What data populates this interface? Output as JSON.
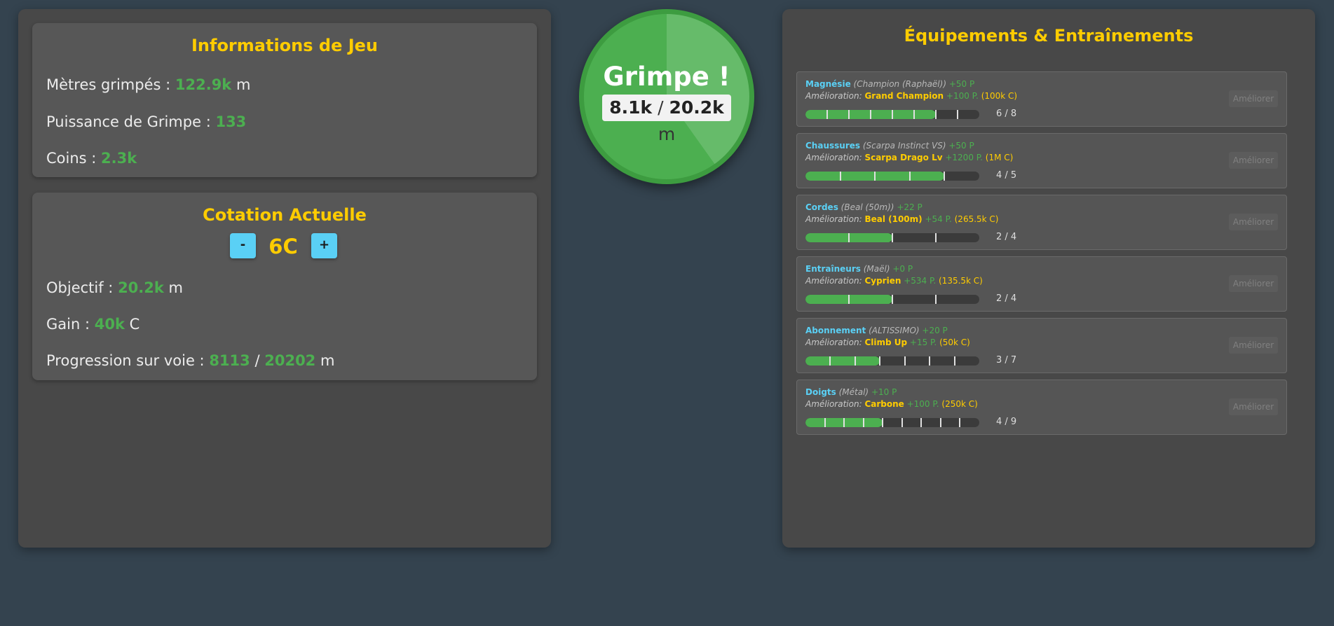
{
  "info": {
    "title": "Informations de Jeu",
    "meters_label": "Mètres grimpés :",
    "meters_value": "122.9k",
    "meters_unit": "m",
    "power_label": "Puissance de Grimpe :",
    "power_value": "133",
    "coins_label": "Coins :",
    "coins_value": "2.3k"
  },
  "grade": {
    "title": "Cotation Actuelle",
    "minus": "-",
    "plus": "+",
    "value": "6C",
    "objective_label": "Objectif :",
    "objective_value": "20.2k",
    "objective_unit": "m",
    "gain_label": "Gain :",
    "gain_value": "40k",
    "gain_unit": "C",
    "progress_label": "Progression sur voie :",
    "progress_current": "8113",
    "progress_sep": "/",
    "progress_total": "20202",
    "progress_unit": "m"
  },
  "climb": {
    "title": "Grimpe !",
    "current": "8.1k",
    "sep": "/",
    "target": "20.2k",
    "unit": "m",
    "progress_fraction": 0.4016
  },
  "equipment": {
    "title": "Équipements & Entraînements",
    "upgrade_label": "Amélioration:",
    "button_label": "Améliorer",
    "items": [
      {
        "name": "Magnésie",
        "current": "(Champion (Raphaël))",
        "bonus": "+50 P",
        "next": "Grand Champion",
        "next_bonus": "+100 P.",
        "cost": "(100k C)",
        "level": 6,
        "max": 8,
        "level_text": "6 / 8"
      },
      {
        "name": "Chaussures",
        "current": "(Scarpa Instinct VS)",
        "bonus": "+50 P",
        "next": "Scarpa Drago Lv",
        "next_bonus": "+1200 P.",
        "cost": "(1M C)",
        "level": 4,
        "max": 5,
        "level_text": "4 / 5"
      },
      {
        "name": "Cordes",
        "current": "(Beal (50m))",
        "bonus": "+22 P",
        "next": "Beal (100m)",
        "next_bonus": "+54 P.",
        "cost": "(265.5k C)",
        "level": 2,
        "max": 4,
        "level_text": "2 / 4"
      },
      {
        "name": "Entraîneurs",
        "current": "(Maël)",
        "bonus": "+0 P",
        "next": "Cyprien",
        "next_bonus": "+534 P.",
        "cost": "(135.5k C)",
        "level": 2,
        "max": 4,
        "level_text": "2 / 4"
      },
      {
        "name": "Abonnement",
        "current": "(ALTISSIMO)",
        "bonus": "+20 P",
        "next": "Climb Up",
        "next_bonus": "+15 P.",
        "cost": "(50k C)",
        "level": 3,
        "max": 7,
        "level_text": "3 / 7"
      },
      {
        "name": "Doigts",
        "current": "(Métal)",
        "bonus": "+10 P",
        "next": "Carbone",
        "next_bonus": "+100 P.",
        "cost": "(250k C)",
        "level": 4,
        "max": 9,
        "level_text": "4 / 9"
      }
    ]
  },
  "colors": {
    "accent_yellow": "#ffcc00",
    "value_green": "#4caf50",
    "name_blue": "#5ad0f5",
    "background": "#34434f"
  }
}
